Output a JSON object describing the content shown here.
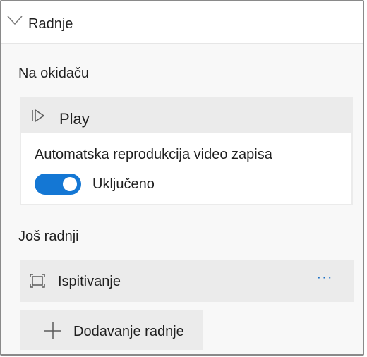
{
  "header": {
    "title": "Radnje",
    "icon": "chevron-down-icon"
  },
  "trigger": {
    "section_label": "Na okidaču",
    "action_title": "Play",
    "action_icon": "play-icon",
    "autoplay_label": "Automatska reprodukcija video zapisa",
    "toggle_state_label": "Uključeno",
    "toggle_on": true
  },
  "more_actions": {
    "section_label": "Još radnji",
    "items": [
      {
        "label": "Ispitivanje",
        "icon": "focus-frame-icon",
        "menu": "···"
      }
    ],
    "add_label": "Dodavanje radnje",
    "add_icon": "plus-icon"
  },
  "colors": {
    "accent": "#1477d4",
    "link": "#1a6fc4",
    "card_bg": "#ebebeb"
  }
}
